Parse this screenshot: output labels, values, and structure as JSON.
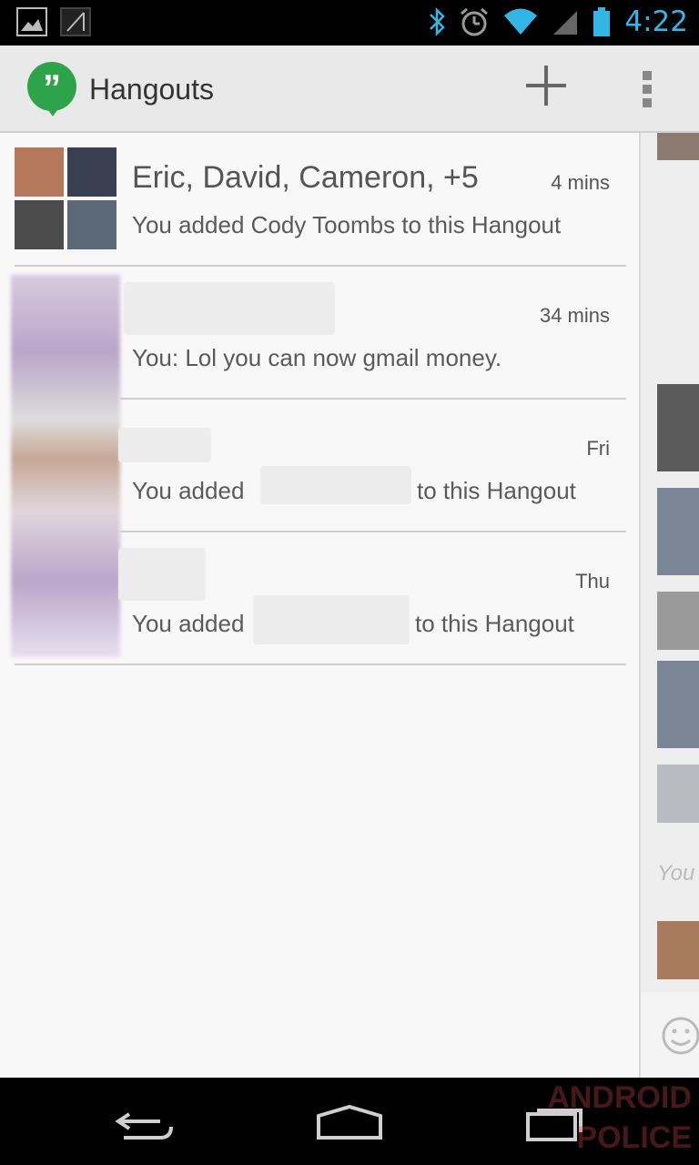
{
  "status_bar": {
    "time": "4:22",
    "icons": [
      "image-icon",
      "signal-icon",
      "bluetooth-icon",
      "alarm-icon",
      "wifi-icon",
      "cell-signal-icon",
      "battery-icon"
    ]
  },
  "action_bar": {
    "title": "Hangouts",
    "actions": [
      "add-icon",
      "overflow-menu-icon"
    ]
  },
  "conversations": [
    {
      "name": "Eric, David, Cameron, +5",
      "snippet": "You added Cody Toombs to this Hangout",
      "time": "4 mins"
    },
    {
      "name": "",
      "snippet": "You: Lol you can now gmail money.",
      "time": "34 mins"
    },
    {
      "name": "",
      "snippet_prefix": "You added",
      "snippet_suffix": "to this Hangout",
      "time": "Fri"
    },
    {
      "name": "",
      "snippet_prefix": "You added",
      "snippet_suffix": "to this Hangout",
      "time": "Thu"
    }
  ],
  "right_panel": {
    "partial_text": "You",
    "icon": "smiley-icon"
  },
  "watermark": "ANDROID POLICE",
  "colors": {
    "accent": "#33b5e5",
    "hangouts_green": "#2ea44a"
  }
}
